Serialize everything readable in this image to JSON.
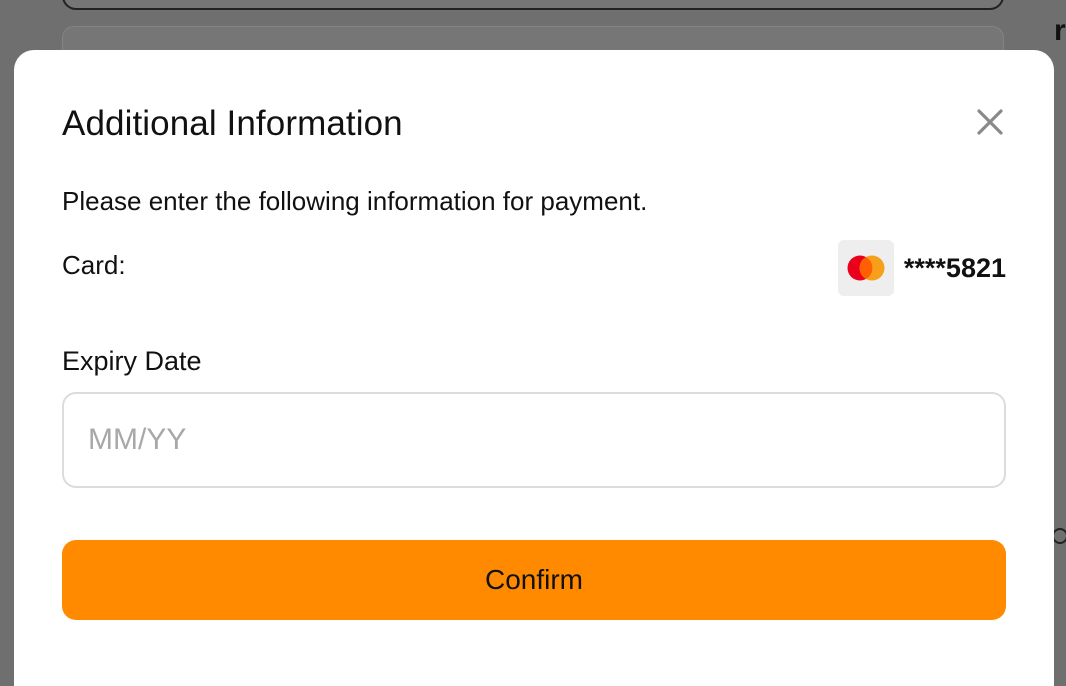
{
  "background": {
    "right_edge_text": "r"
  },
  "modal": {
    "title": "Additional Information",
    "close_icon": "close-icon",
    "intro": "Please enter the following information for payment.",
    "card": {
      "label": "Card:",
      "brand_icon": "mastercard-icon",
      "masked_number": "****5821"
    },
    "expiry": {
      "label": "Expiry Date",
      "placeholder": "MM/YY",
      "value": ""
    },
    "confirm_label": "Confirm"
  },
  "colors": {
    "accent": "#ff8a00",
    "overlay": "#6f6f6f",
    "mastercard_red": "#eb001b",
    "mastercard_orange": "#f79e1b"
  }
}
